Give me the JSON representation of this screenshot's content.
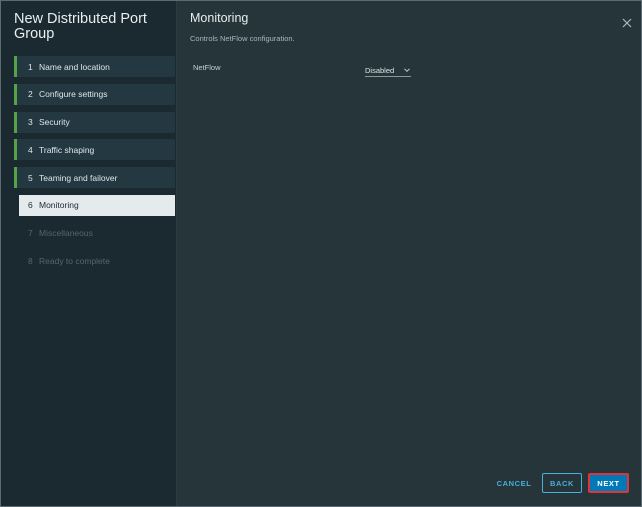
{
  "wizard": {
    "title": "New Distributed Port Group",
    "steps": [
      {
        "num": "1",
        "label": "Name and location",
        "state": "done"
      },
      {
        "num": "2",
        "label": "Configure settings",
        "state": "done"
      },
      {
        "num": "3",
        "label": "Security",
        "state": "done"
      },
      {
        "num": "4",
        "label": "Traffic shaping",
        "state": "done"
      },
      {
        "num": "5",
        "label": "Teaming and failover",
        "state": "done"
      },
      {
        "num": "6",
        "label": "Monitoring",
        "state": "active"
      },
      {
        "num": "7",
        "label": "Miscellaneous",
        "state": "pending"
      },
      {
        "num": "8",
        "label": "Ready to complete",
        "state": "pending"
      }
    ]
  },
  "main": {
    "title": "Monitoring",
    "description": "Controls NetFlow configuration.",
    "netflow": {
      "label": "NetFlow",
      "value": "Disabled"
    },
    "close_icon": "close-icon"
  },
  "footer": {
    "cancel_label": "CANCEL",
    "back_label": "BACK",
    "next_label": "NEXT"
  },
  "colors": {
    "accent": "#49afd9",
    "primary_button": "#0079b8",
    "completed_step": "#56a347",
    "highlight_border": "#e03538"
  }
}
